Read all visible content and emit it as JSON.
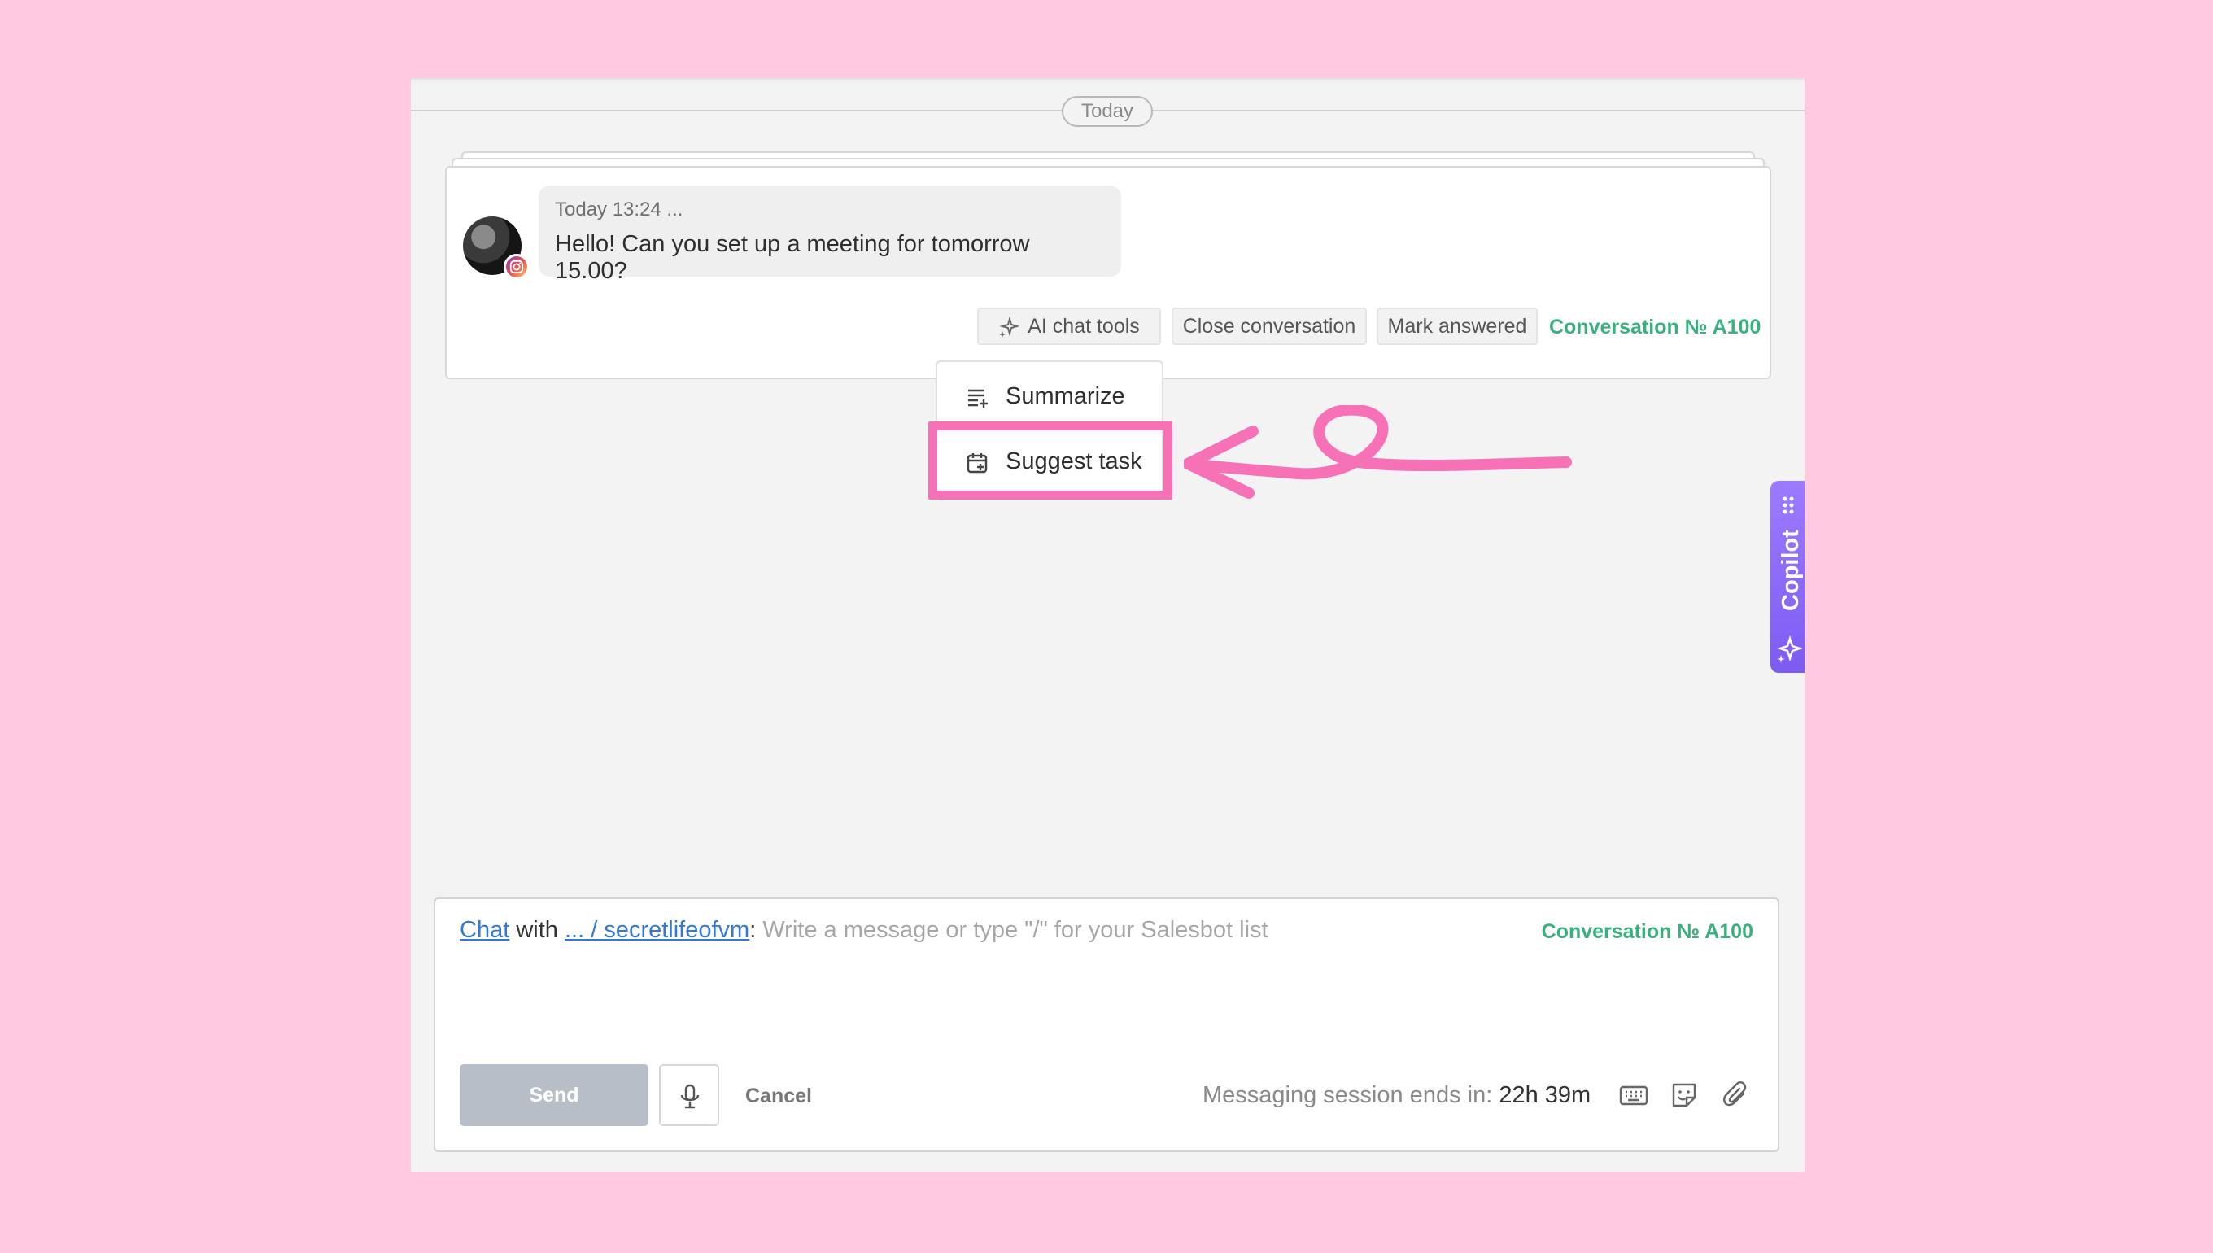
{
  "divider": {
    "label": "Today"
  },
  "message": {
    "time": "Today 13:24 ...",
    "text": "Hello! Can you set up a meeting for tomorrow 15.00?",
    "channel_icon": "instagram-icon"
  },
  "actions": {
    "ai_tools_label": "AI chat tools",
    "close_label": "Close conversation",
    "mark_answered_label": "Mark answered",
    "conversation_label": "Conversation № A100"
  },
  "ai_menu": {
    "items": [
      {
        "label": "Summarize",
        "icon": "summarize-icon"
      },
      {
        "label": "Suggest task",
        "icon": "calendar-add-icon"
      }
    ],
    "highlighted": "Suggest task",
    "annotation_color": "#f771b6"
  },
  "copilot": {
    "label": "Copilot"
  },
  "composer": {
    "chat_link": "Chat",
    "with_text": "with",
    "contact_link": "... / secretlifeofvm",
    "colon": ":",
    "placeholder": "Write a message or type \"/\" for your Salesbot list",
    "conversation_label": "Conversation № A100",
    "send_label": "Send",
    "cancel_label": "Cancel",
    "session_label": "Messaging session ends in:",
    "session_value": "22h 39m"
  },
  "colors": {
    "background": "#ffc9e0",
    "accent_green": "#3ab07f",
    "link_blue": "#3478d6",
    "copilot_purple": "#8a68f7",
    "send_disabled": "#b7bec8"
  }
}
